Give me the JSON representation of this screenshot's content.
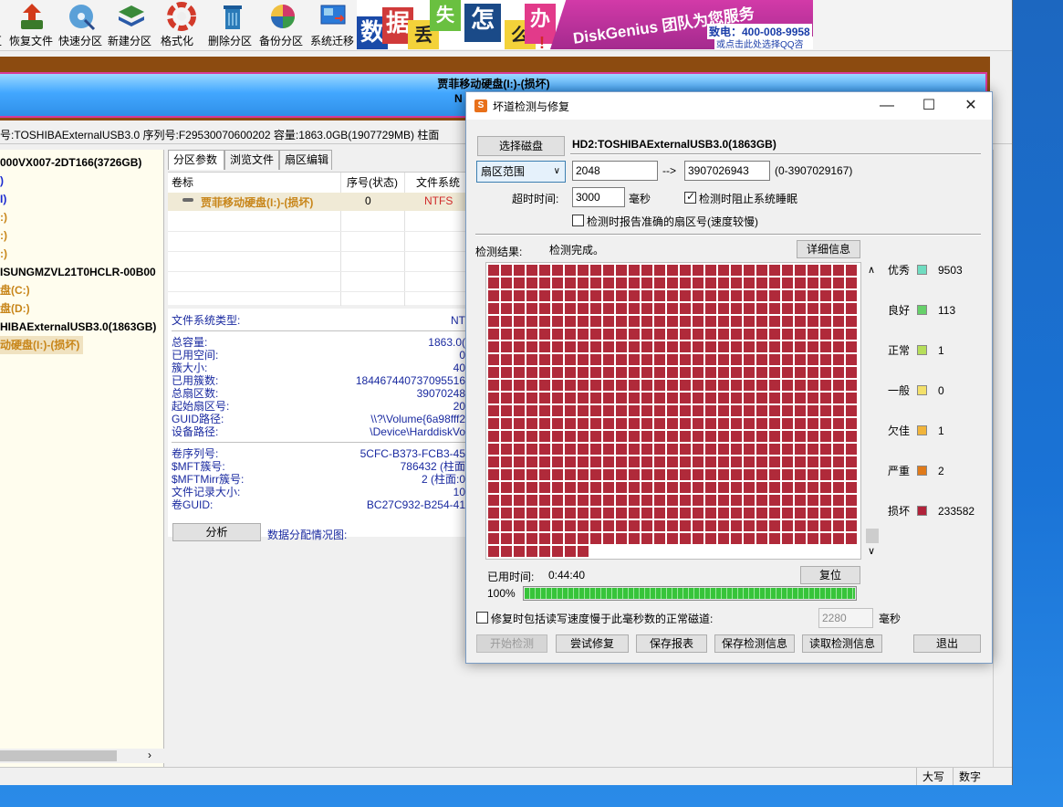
{
  "toolbar": {
    "items": [
      {
        "label": "区",
        "icon": "partition-icon"
      },
      {
        "label": "恢复文件",
        "icon": "recover-files-icon"
      },
      {
        "label": "快速分区",
        "icon": "quick-partition-icon"
      },
      {
        "label": "新建分区",
        "icon": "new-partition-icon"
      },
      {
        "label": "格式化",
        "icon": "format-icon"
      },
      {
        "label": "删除分区",
        "icon": "delete-partition-icon"
      },
      {
        "label": "备份分区",
        "icon": "backup-partition-icon"
      },
      {
        "label": "系统迁移",
        "icon": "system-migration-icon"
      }
    ],
    "banner": {
      "chars": [
        "数",
        "据",
        "丢",
        "失",
        "怎",
        "么",
        "办",
        "!"
      ],
      "brand": "DiskGenius 团队为您服务",
      "phone": "致电：400-008-9958",
      "qq": "或点击此处选择QQ咨询"
    }
  },
  "diskbar": {
    "title": "贾菲移动硬盘(I:)-(损坏)",
    "fs": "N"
  },
  "infoline": "号:TOSHIBAExternalUSB3.0  序列号:F29530070600202  容量:1863.0GB(1907729MB)  柱面",
  "tree": {
    "items": [
      {
        "text": "000VX007-2DT166(3726GB)",
        "color": "#000000",
        "hl": false
      },
      {
        "text": ")",
        "color": "#1a2ad0",
        "hl": false
      },
      {
        "text": "I)",
        "color": "#1a2ad0",
        "hl": false
      },
      {
        "text": ":)",
        "color": "#c8861a",
        "hl": false
      },
      {
        "text": ":)",
        "color": "#c8861a",
        "hl": false
      },
      {
        "text": ":)",
        "color": "#c8861a",
        "hl": false
      },
      {
        "text": "ISUNGMZVL21T0HCLR-00B00",
        "color": "#000000",
        "hl": false
      },
      {
        "text": "盘(C:)",
        "color": "#c8861a",
        "hl": false
      },
      {
        "text": "盘(D:)",
        "color": "#c8861a",
        "hl": false
      },
      {
        "text": "HIBAExternalUSB3.0(1863GB)",
        "color": "#000000",
        "hl": false
      },
      {
        "text": "动硬盘(I:)-(损坏)",
        "color": "#c8861a",
        "hl": true
      }
    ]
  },
  "tabs": [
    "分区参数",
    "浏览文件",
    "扇区编辑"
  ],
  "ptable": {
    "headers": [
      "卷标",
      "序号(状态)",
      "文件系统"
    ],
    "row": {
      "label": "贾菲移动硬盘(I:)-(损坏)",
      "index": "0",
      "fs": "NTFS"
    }
  },
  "props": {
    "fs_type_key": "文件系统类型:",
    "fs_type_val": "NT",
    "group1": [
      {
        "k": "总容量:",
        "v": "1863.0("
      },
      {
        "k": "已用空间:",
        "v": "0"
      },
      {
        "k": "簇大小:",
        "v": "40"
      },
      {
        "k": "已用簇数:",
        "v": "184467440737095516"
      },
      {
        "k": "总扇区数:",
        "v": "39070248"
      },
      {
        "k": "起始扇区号:",
        "v": "20"
      },
      {
        "k": "GUID路径:",
        "v": "\\\\?\\Volume{6a98fff2"
      },
      {
        "k": "设备路径:",
        "v": "\\Device\\HarddiskVo"
      }
    ],
    "group2": [
      {
        "k": "卷序列号:",
        "v": "5CFC-B373-FCB3-45"
      },
      {
        "k": "$MFT簇号:",
        "v": "786432 (柱面"
      },
      {
        "k": "$MFTMirr簇号:",
        "v": "2 (柱面:0"
      },
      {
        "k": "文件记录大小:",
        "v": "10"
      },
      {
        "k": "卷GUID:",
        "v": "BC27C932-B254-41"
      }
    ],
    "analyze_label": "分析",
    "distribution_label": "数据分配情况图:"
  },
  "statusbar": [
    "大写",
    "数字"
  ],
  "dialog": {
    "title": "坏道检测与修复",
    "icon_glyph": "S",
    "select_disk_label": "选择磁盘",
    "disk_name": "HD2:TOSHIBAExternalUSB3.0(1863GB)",
    "range_mode": "扇区范围",
    "range_start": "2048",
    "range_arrow": "-->",
    "range_end": "3907026943",
    "range_hint": "(0-3907029167)",
    "timeout_label": "超时时间:",
    "timeout_value": "3000",
    "timeout_unit": "毫秒",
    "prevent_sleep_label": "检测时阻止系统睡眠",
    "prevent_sleep_checked": true,
    "report_sector_label": "检测时报告准确的扇区号(速度较慢)",
    "report_sector_checked": false,
    "result_label": "检测结果:",
    "result_value": "检测完成。",
    "detail_label": "详细信息",
    "grid": {
      "cols": 29,
      "rows": 23,
      "last_row_cells": 8,
      "cell_color": "#b02a3a"
    },
    "legend": [
      {
        "name": "优秀",
        "color": "#6fdcc0",
        "count": "9503"
      },
      {
        "name": "良好",
        "color": "#66d06a",
        "count": "113"
      },
      {
        "name": "正常",
        "color": "#b6de5a",
        "count": "1"
      },
      {
        "name": "一般",
        "color": "#f3e06a",
        "count": "0"
      },
      {
        "name": "欠佳",
        "color": "#f1b43a",
        "count": "1"
      },
      {
        "name": "严重",
        "color": "#e07a1a",
        "count": "2"
      },
      {
        "name": "损坏",
        "color": "#b0223a",
        "count": "233582"
      }
    ],
    "elapsed_label": "已用时间:",
    "elapsed_value": "0:44:40",
    "reset_label": "复位",
    "progress_text": "100%",
    "progress_value": 1.0,
    "repair_option_label": "修复时包括读写速度慢于此毫秒数的正常磁道:",
    "repair_option_checked": false,
    "repair_ms_value": "2280",
    "repair_ms_unit": "毫秒",
    "buttons": {
      "start": "开始检测",
      "try_repair": "尝试修复",
      "save_report": "保存报表",
      "save_info": "保存检测信息",
      "load_info": "读取检测信息",
      "exit": "退出"
    },
    "window_controls": {
      "minimize": "—",
      "maximize": "☐",
      "close": "✕"
    }
  }
}
